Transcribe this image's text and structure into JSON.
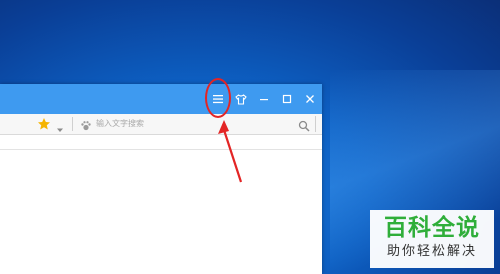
{
  "window_controls": {
    "menu_icon": "hamburger-menu-icon",
    "skin_icon": "tshirt-skin-icon",
    "minimize_icon": "minimize-icon",
    "maximize_icon": "maximize-icon",
    "close_icon": "close-icon"
  },
  "toolbar": {
    "favorite_icon": "star-icon",
    "search_placeholder": "输入文字搜索"
  },
  "annotation": {
    "color": "#e32525"
  },
  "watermark": {
    "title": "百科全说",
    "subtitle": "助你轻松解决",
    "title_color": "#2fae3a"
  },
  "colors": {
    "titlebar": "#3e9af0",
    "desktop": "#0d5fc2"
  }
}
